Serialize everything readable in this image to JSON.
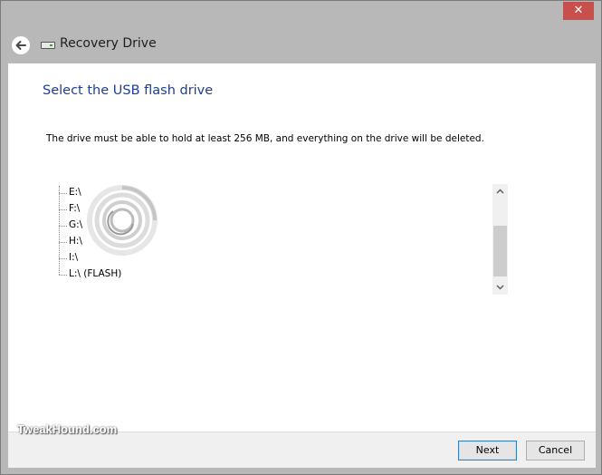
{
  "window": {
    "title": "Recovery Drive",
    "close_glyph": "✕"
  },
  "content": {
    "heading": "Select the USB flash drive",
    "description": "The drive must be able to hold at least 256 MB, and everything on the drive will be deleted."
  },
  "drives": [
    {
      "label": "E:\\"
    },
    {
      "label": "F:\\"
    },
    {
      "label": "G:\\"
    },
    {
      "label": "H:\\"
    },
    {
      "label": "I:\\"
    },
    {
      "label": "L:\\ (FLASH)"
    }
  ],
  "footer": {
    "next_label": "Next",
    "cancel_label": "Cancel"
  },
  "watermark": "TweakHound.com",
  "icons": {
    "back": "back-arrow-icon",
    "drive": "usb-drive-icon",
    "scroll_up": "chevron-up-icon",
    "scroll_down": "chevron-down-icon"
  },
  "colors": {
    "heading": "#1e3f91",
    "close": "#c7504c",
    "chrome": "#b8b8b8"
  }
}
